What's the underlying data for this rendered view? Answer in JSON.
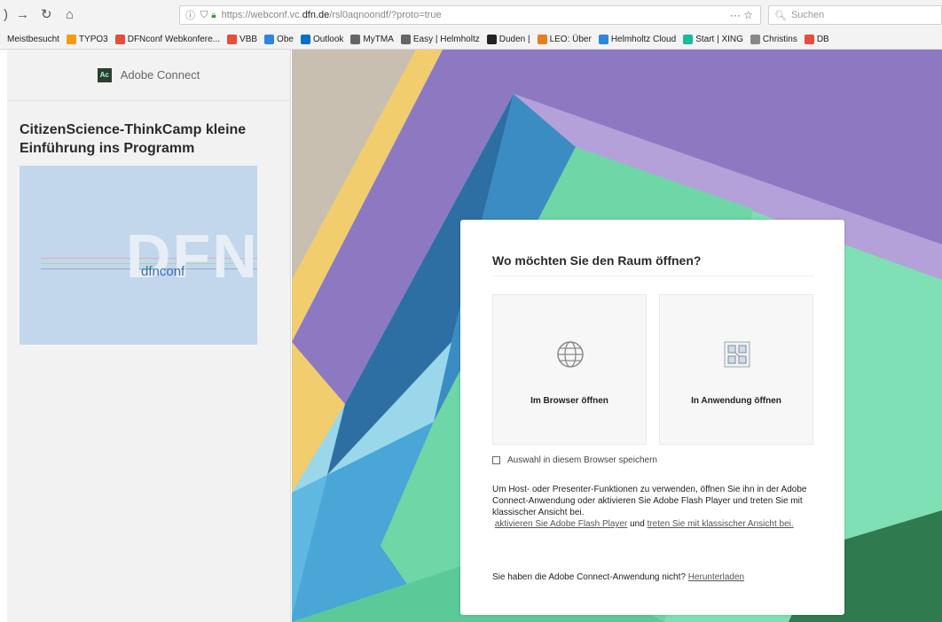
{
  "browser": {
    "url_prefix": "https://webconf.vc.",
    "url_domain": "dfn.de",
    "url_suffix": "/rsl0aqnoondf/?proto=true",
    "url_actions": "··· ☆",
    "search_placeholder": "Suchen"
  },
  "bookmarks": [
    {
      "label": "Meistbesucht",
      "color": ""
    },
    {
      "label": "TYPO3",
      "color": "#f39c12"
    },
    {
      "label": "DFNconf Webkonfere...",
      "color": "#e74c3c"
    },
    {
      "label": "VBB",
      "color": "#e74c3c"
    },
    {
      "label": "Obe",
      "color": "#2e86de"
    },
    {
      "label": "Outlook",
      "color": "#0072c6"
    },
    {
      "label": "MyTMA",
      "color": "#666666"
    },
    {
      "label": "Easy | Helmholtz",
      "color": "#666666"
    },
    {
      "label": "Duden |",
      "color": "#222222"
    },
    {
      "label": "LEO: Über",
      "color": "#e67e22"
    },
    {
      "label": "Helmholtz Cloud",
      "color": "#2e86de"
    },
    {
      "label": "Start | XING",
      "color": "#1abc9c"
    },
    {
      "label": "Christins",
      "color": "#888888"
    },
    {
      "label": "DB",
      "color": "#e74c3c"
    }
  ],
  "sidebar": {
    "app_name": "Adobe Connect",
    "logo_text": "Ac",
    "meeting_title": "CitizenScience-ThinkCamp kleine Einführung ins Programm",
    "image_big_text": "DFN",
    "image_small_text": "dfnconf"
  },
  "dialog": {
    "title": "Wo möchten Sie den Raum öffnen?",
    "browser_option": "Im Browser öffnen",
    "app_option": "In Anwendung öffnen",
    "remember_label": "Auswahl in diesem Browser speichern",
    "info_text": "Um Host- oder Presenter-Funktionen zu verwenden, öffnen Sie ihn in der Adobe Connect-Anwendung oder aktivieren Sie Adobe Flash Player und treten Sie mit klassischer Ansicht bei.",
    "flash_link": "aktivieren Sie Adobe Flash Player",
    "and_text": "und",
    "classic_link": "treten Sie mit klassischer Ansicht bei.",
    "download_question": "Sie haben die Adobe Connect-Anwendung nicht?",
    "download_link": "Herunterladen"
  }
}
